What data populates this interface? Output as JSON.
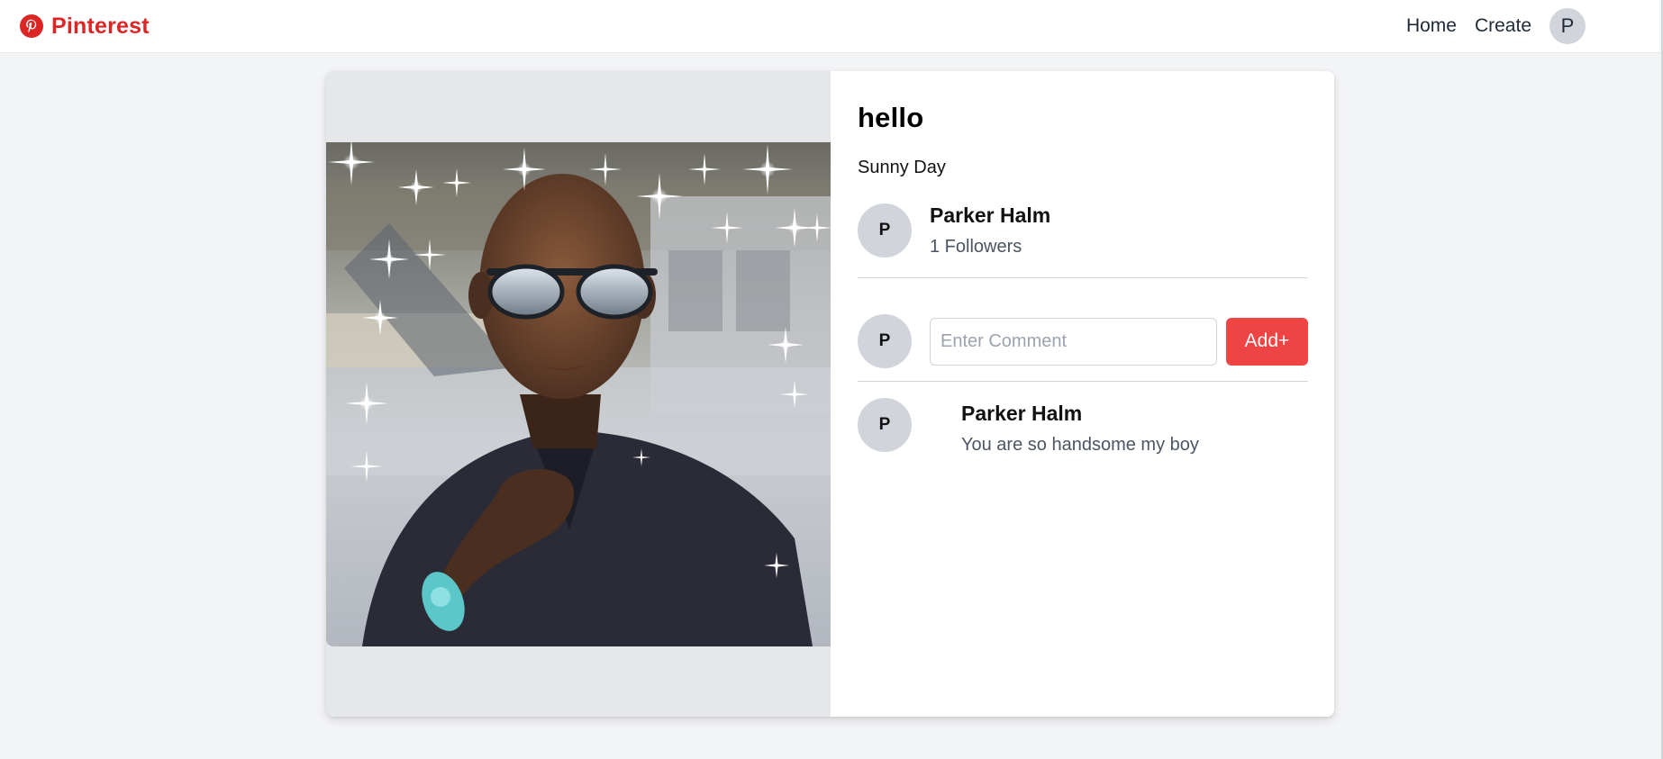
{
  "app": {
    "name": "Pinterest",
    "brand_color": "#dc2626",
    "brand_icon": "pinterest-logo-icon"
  },
  "nav": {
    "home_label": "Home",
    "create_label": "Create",
    "avatar_initial": "P"
  },
  "pin": {
    "title": "hello",
    "description": "Sunny Day",
    "image_alt": "Selfie photo of a man wearing sunglasses and a dark shirt with sparkle effects"
  },
  "author": {
    "initial": "P",
    "name": "Parker Halm",
    "followers": "1 Followers"
  },
  "comment_form": {
    "avatar_initial": "P",
    "placeholder": "Enter Comment",
    "value": "",
    "submit_label": "Add+",
    "submit_color": "#ef4444"
  },
  "comments": [
    {
      "initial": "P",
      "author": "Parker Halm",
      "text": "You are so handsome my boy"
    }
  ]
}
